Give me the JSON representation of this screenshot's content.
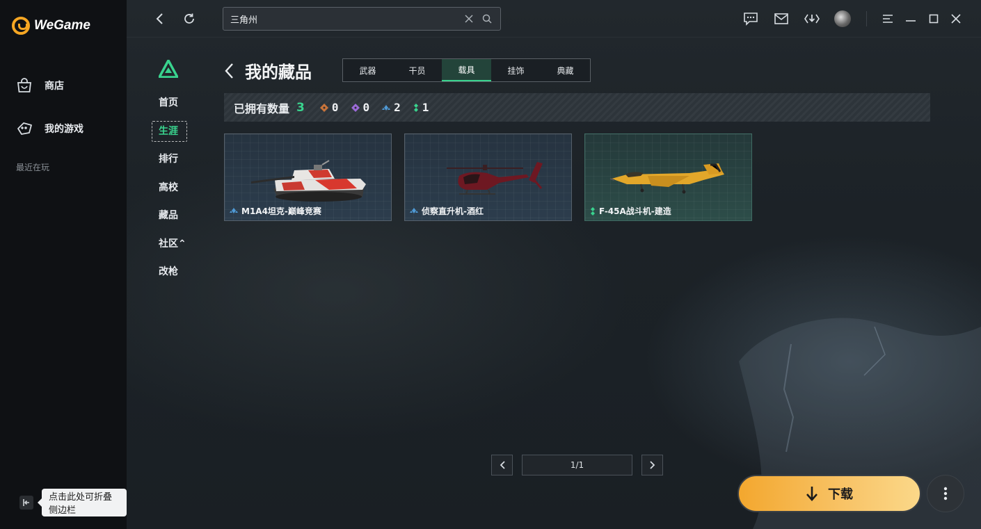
{
  "app": {
    "logo_text": "WeGame"
  },
  "sidebar": {
    "items": [
      {
        "label": "商店",
        "icon": "store-icon"
      },
      {
        "label": "我的游戏",
        "icon": "my-games-icon"
      }
    ],
    "recent_label": "最近在玩",
    "collapse_tooltip": "点击此处可折叠侧边栏"
  },
  "search": {
    "value": "三角州",
    "placeholder": ""
  },
  "game_nav": {
    "items": [
      {
        "label": "首页",
        "active": false
      },
      {
        "label": "生涯",
        "active": true
      },
      {
        "label": "排行",
        "active": false
      },
      {
        "label": "高校",
        "active": false
      },
      {
        "label": "藏品",
        "active": false
      },
      {
        "label": "社区⌃",
        "active": false
      },
      {
        "label": "改枪",
        "active": false
      }
    ]
  },
  "page": {
    "title": "我的藏品",
    "tabs": [
      {
        "label": "武器",
        "active": false
      },
      {
        "label": "干员",
        "active": false
      },
      {
        "label": "载具",
        "active": true
      },
      {
        "label": "挂饰",
        "active": false
      },
      {
        "label": "典藏",
        "active": false
      }
    ],
    "summary": {
      "label": "已拥有数量",
      "total": "3",
      "rarities": [
        {
          "name": "orange",
          "color": "#c9743a",
          "count": "0"
        },
        {
          "name": "purple",
          "color": "#9b6ad8",
          "count": "0"
        },
        {
          "name": "blue",
          "color": "#4f9ad6",
          "count": "2"
        },
        {
          "name": "green",
          "color": "#39d38e",
          "count": "1"
        }
      ]
    },
    "items": [
      {
        "name": "M1A4坦克-巅峰竞赛",
        "rarity": "blue",
        "art": "tank"
      },
      {
        "name": "侦察直升机-酒红",
        "rarity": "blue",
        "art": "helicopter"
      },
      {
        "name": "F-45A战斗机-建造",
        "rarity": "green",
        "art": "jet"
      }
    ],
    "pagination": {
      "text": "1/1"
    }
  },
  "download_button": {
    "label": "下载"
  },
  "colors": {
    "accent_green": "#39d38e",
    "download_orange": "#f3a72e"
  }
}
